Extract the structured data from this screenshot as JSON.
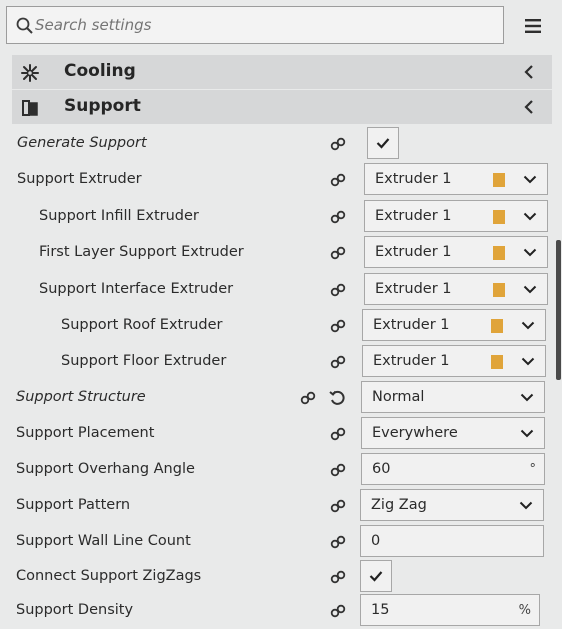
{
  "search": {
    "placeholder": "Search settings"
  },
  "categories": [
    {
      "label": "Cooling"
    },
    {
      "label": "Support"
    }
  ],
  "settings": [
    {
      "label": "Generate Support",
      "type": "checkbox",
      "checked": true
    },
    {
      "label": "Support Extruder",
      "type": "extruder",
      "value": "Extruder 1"
    },
    {
      "label": "Support Infill Extruder",
      "type": "extruder",
      "value": "Extruder 1"
    },
    {
      "label": "First Layer Support Extruder",
      "type": "extruder",
      "value": "Extruder 1"
    },
    {
      "label": "Support Interface Extruder",
      "type": "extruder",
      "value": "Extruder 1"
    },
    {
      "label": "Support Roof Extruder",
      "type": "extruder",
      "value": "Extruder 1"
    },
    {
      "label": "Support Floor Extruder",
      "type": "extruder",
      "value": "Extruder 1"
    },
    {
      "label": "Support Structure",
      "type": "dropdown",
      "value": "Normal"
    },
    {
      "label": "Support Placement",
      "type": "dropdown",
      "value": "Everywhere"
    },
    {
      "label": "Support Overhang Angle",
      "type": "number",
      "value": "60",
      "unit": "°"
    },
    {
      "label": "Support Pattern",
      "type": "dropdown",
      "value": "Zig Zag"
    },
    {
      "label": "Support Wall Line Count",
      "type": "number",
      "value": "0"
    },
    {
      "label": "Connect Support ZigZags",
      "type": "checkbox",
      "checked": true
    },
    {
      "label": "Support Density",
      "type": "number",
      "value": "15",
      "unit": "%"
    }
  ],
  "colors": {
    "extruder_swatch": "#e0a43a",
    "panel_bg": "#e9eaea",
    "category_bg": "#d6d7d8"
  }
}
